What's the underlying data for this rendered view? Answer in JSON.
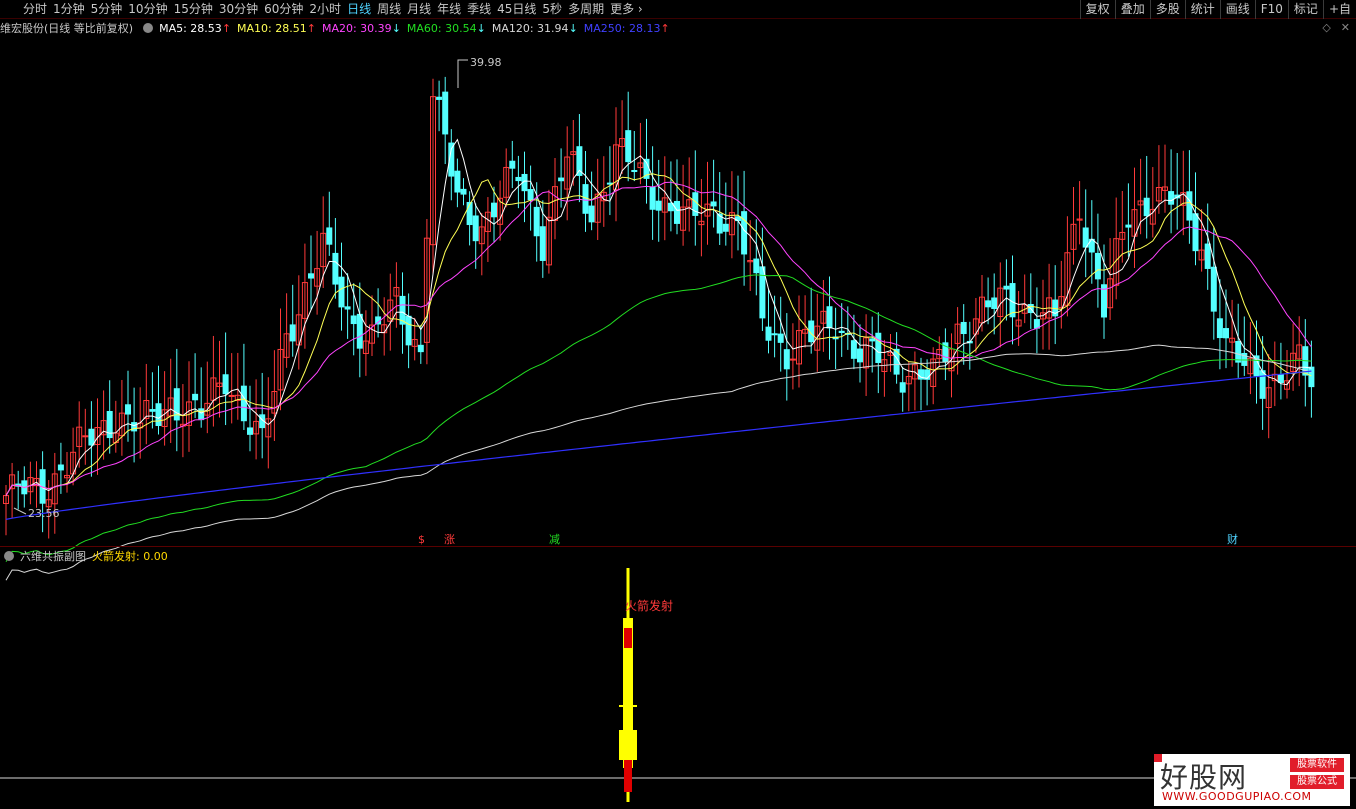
{
  "toolbar": {
    "periods": [
      "分时",
      "1分钟",
      "5分钟",
      "10分钟",
      "15分钟",
      "30分钟",
      "60分钟",
      "2小时",
      "日线",
      "周线",
      "月线",
      "年线",
      "季线",
      "45日线",
      "5秒",
      "多周期",
      "更多"
    ],
    "active_period": "日线",
    "buttons": [
      "复权",
      "叠加",
      "多股",
      "统计",
      "画线",
      "F10",
      "标记",
      "+自"
    ]
  },
  "info": {
    "stock_title": "维宏股份(日线 等比前复权)",
    "ma5": "MA5: 28.53",
    "ma10": "MA10: 28.51",
    "ma20": "MA20: 30.39",
    "ma60": "MA60: 30.54",
    "ma120": "MA120: 31.94",
    "ma250": "MA250: 28.13",
    "ma5_arrow": "↑",
    "ma10_arrow": "↑",
    "ma20_arrow": "↓",
    "ma60_arrow": "↓",
    "ma120_arrow": "↓",
    "ma250_arrow": "↑"
  },
  "colors": {
    "up": "#ff3a3a",
    "down": "#54ffff",
    "ma5": "#ffffff",
    "ma10": "#ffff55",
    "ma20": "#ff44ff",
    "ma60": "#22dd22",
    "ma120": "#d8d8d8",
    "ma250": "#3030ff"
  },
  "chart_data": {
    "type": "candlestick",
    "high_label": "39.98",
    "low_label": "23.56",
    "price_range": [
      23.0,
      41.5
    ],
    "markers": [
      "$",
      "涨",
      "减",
      "财"
    ]
  },
  "sub": {
    "title": "六维共振副图",
    "value_text": "火箭发射: 0.00",
    "signal_label": "火箭发射"
  },
  "watermark": {
    "title": "好股网",
    "tag1": "股票软件",
    "tag2": "股票公式",
    "url": "WWW.GOODGUPIAO.COM"
  }
}
